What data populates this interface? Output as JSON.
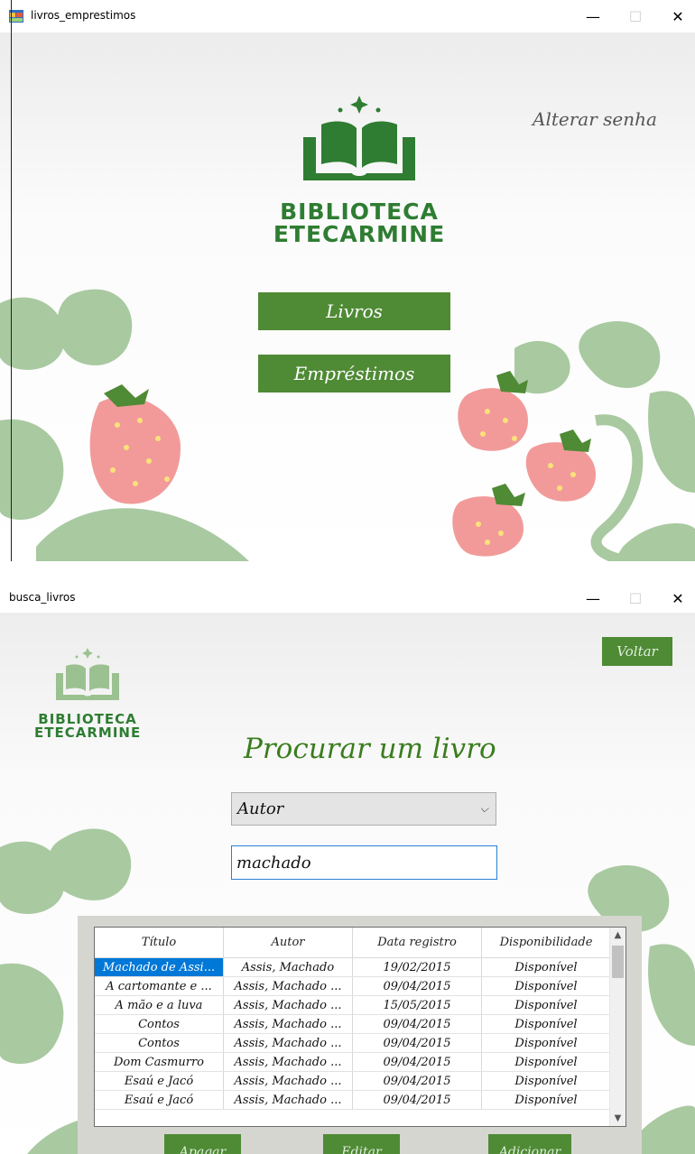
{
  "window1": {
    "title": "livros_emprestimos",
    "controls": {
      "minimize": "—",
      "maximize": "☐",
      "close": "✕"
    },
    "change_password_link": "Alterar senha",
    "logo": {
      "line1": "BIBLIOTECA",
      "line2": "ETECARMINE"
    },
    "books_button": "Livros",
    "loans_button": "Empréstimos"
  },
  "window2": {
    "title": "busca_livros",
    "controls": {
      "minimize": "—",
      "maximize": "☐",
      "close": "✕"
    },
    "back_button": "Voltar",
    "logo": {
      "line1": "BIBLIOTECA",
      "line2": "ETECARMINE"
    },
    "heading": "Procurar um livro",
    "search_by": {
      "selected": "Autor"
    },
    "search_input": {
      "value": "machado"
    },
    "table": {
      "columns": [
        "Título",
        "Autor",
        "Data registro",
        "Disponibilidade"
      ],
      "rows": [
        [
          "Machado de Assi...",
          "Assis, Machado",
          "19/02/2015",
          "Disponível"
        ],
        [
          "A cartomante e ...",
          "Assis, Machado ...",
          "09/04/2015",
          "Disponível"
        ],
        [
          "A mão e a luva",
          "Assis, Machado ...",
          "15/05/2015",
          "Disponível"
        ],
        [
          "Contos",
          "Assis, Machado ...",
          "09/04/2015",
          "Disponível"
        ],
        [
          "Contos",
          "Assis, Machado ...",
          "09/04/2015",
          "Disponível"
        ],
        [
          "Dom Casmurro",
          "Assis, Machado ...",
          "09/04/2015",
          "Disponível"
        ],
        [
          "Esaú e Jacó",
          "Assis, Machado ...",
          "09/04/2015",
          "Disponível"
        ],
        [
          "Esaú e Jacó",
          "Assis, Machado ...",
          "09/04/2015",
          "Disponível"
        ]
      ]
    },
    "delete_button": "Apagar",
    "edit_button": "Editar",
    "add_button": "Adicionar"
  },
  "colors": {
    "brand_green": "#4f8a35",
    "logo_green": "#2e7d32",
    "leaf": "#a9c9a1",
    "strawberry": "#f08a8a",
    "selection": "#0078d7"
  }
}
